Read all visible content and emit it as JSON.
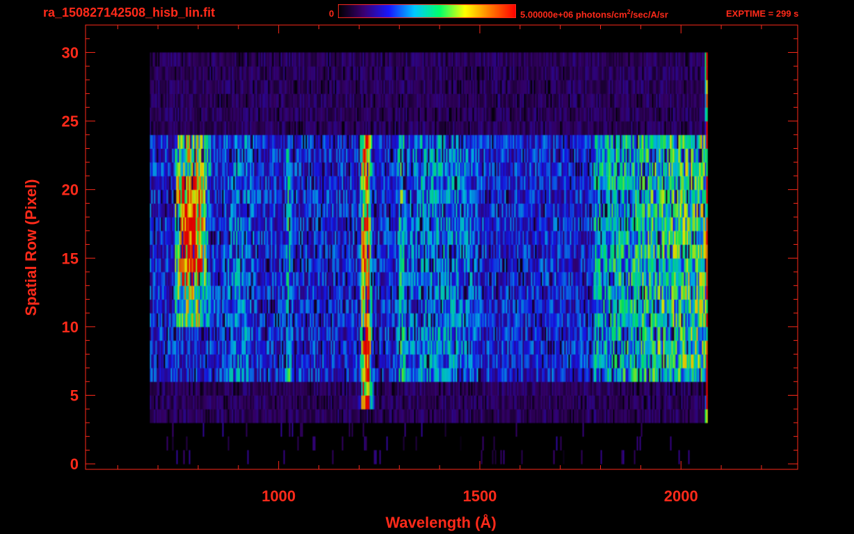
{
  "header": {
    "file_title": "ra_150827142508_hisb_lin.fit",
    "colorbar_min_label": "0",
    "colorbar_max_value": "5.00000e+06 photons/cm",
    "colorbar_max_exp": "2",
    "colorbar_max_unit": "/sec/A/sr",
    "exptime": "EXPTIME = 299 s"
  },
  "colors": {
    "axis": "#ff2a1a",
    "background": "#000000",
    "colormap": [
      "#000000",
      "#3a0070",
      "#1818ff",
      "#00c8ff",
      "#00ff6a",
      "#ffff00",
      "#ff7a00",
      "#ff0000"
    ]
  },
  "chart_data": {
    "type": "heatmap",
    "title": "ra_150827142508_hisb_lin.fit",
    "xlabel": "Wavelength (Å)",
    "ylabel": "Spatial Row (Pixel)",
    "xlim": [
      520,
      2290
    ],
    "ylim": [
      -0.4,
      32
    ],
    "x_ticks": [
      1000,
      1500,
      2000
    ],
    "y_ticks": [
      0,
      5,
      10,
      15,
      20,
      25,
      30
    ],
    "x_minor_step": 100,
    "y_minor_step": 1,
    "value_range": [
      0,
      5000000
    ],
    "value_unit": "photons/cm^2/sec/A/sr",
    "exptime_s": 299,
    "grid": false,
    "detector_rows": [
      0,
      30
    ],
    "detector_wavelength_range": [
      680,
      2065
    ],
    "illuminated_rows": [
      6,
      24
    ],
    "features": [
      {
        "type": "lyman_continuum_blob",
        "x_range": [
          740,
          860
        ],
        "y_range": [
          10,
          24
        ],
        "peak_x": 780,
        "peak_y": [
          13,
          21
        ],
        "intensity": 1.0
      },
      {
        "type": "emission_line",
        "x": 1216,
        "y_range": [
          4,
          24
        ],
        "intensity": 0.9
      },
      {
        "type": "emission_line",
        "x": 1304,
        "y_range": [
          6,
          24
        ],
        "intensity": 0.45
      },
      {
        "type": "emission_line",
        "x": 1356,
        "y_range": [
          6,
          24
        ],
        "intensity": 0.35
      },
      {
        "type": "emission_line",
        "x": 1025,
        "y_range": [
          6,
          23
        ],
        "intensity": 0.4
      },
      {
        "type": "emission_band",
        "x_range": [
          1780,
          2065
        ],
        "y_range": [
          6,
          24
        ],
        "intensity": 0.55
      },
      {
        "type": "edge_line",
        "x": 2063,
        "y_range": [
          2,
          30
        ],
        "intensity": 0.85
      }
    ]
  }
}
